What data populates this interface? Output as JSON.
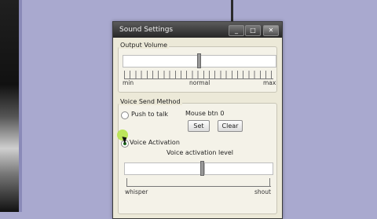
{
  "window": {
    "title": "Sound Settings",
    "min_glyph": "_",
    "max_glyph": "□",
    "close_glyph": "✕"
  },
  "output_volume": {
    "label": "Output Volume",
    "level_percent": 50,
    "tick_min": "min",
    "tick_mid": "normal",
    "tick_max": "max"
  },
  "voice_send": {
    "label": "Voice Send Method",
    "push_to_talk": "Push to talk",
    "mouse_binding": "Mouse btn 0",
    "set_button": "Set",
    "clear_button": "Clear",
    "voice_activation": "Voice Activation",
    "selected": "Voice Activation",
    "activation_level_label": "Voice activation level",
    "activation_level_percent": 50,
    "tick_min": "whisper",
    "tick_max": "shout"
  },
  "colors": {
    "background": "#a9a9cf",
    "titlebar": "#3a3a3a",
    "cursor_highlight": "#b6e44a"
  }
}
